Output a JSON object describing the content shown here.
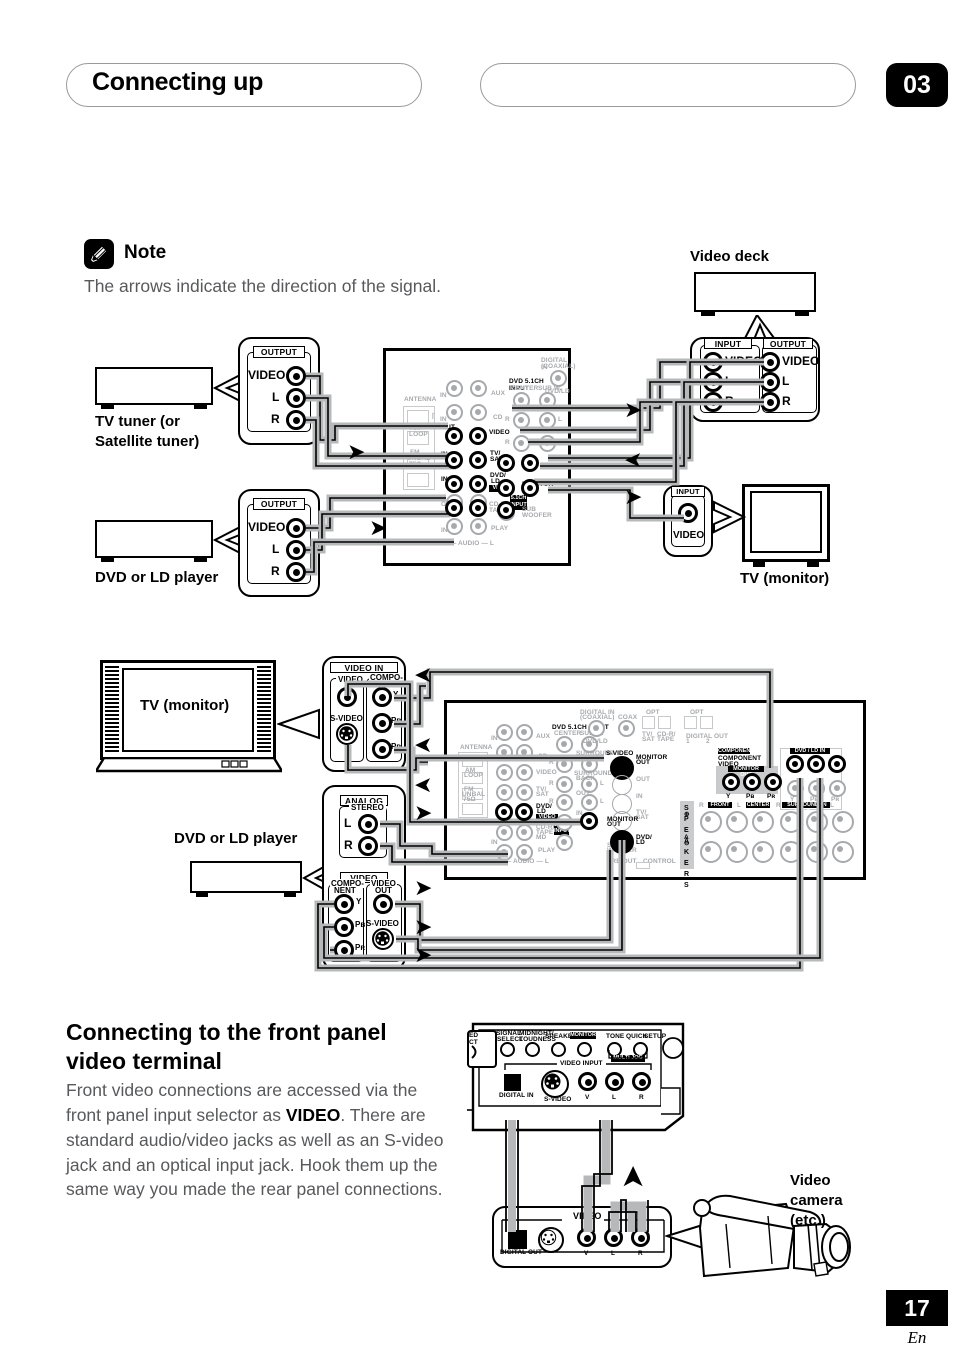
{
  "header": {
    "title": "Connecting up",
    "chapter": "03"
  },
  "note": {
    "icon": "pencil-note-icon",
    "label": "Note",
    "text": "The arrows indicate the direction of the signal."
  },
  "diagram_top": {
    "devices": {
      "tv_tuner": "TV tuner (or\nSatellite tuner)",
      "tv_tuner_line1": "TV tuner (or",
      "tv_tuner_line2": "Satellite tuner)",
      "dvd_player": "DVD or LD player",
      "video_deck": "Video deck",
      "tv_monitor": "TV (monitor)"
    },
    "tuner_panel": {
      "caption": "OUTPUT",
      "jacks": [
        "VIDEO",
        "L",
        "R"
      ]
    },
    "dvd_panel": {
      "caption": "OUTPUT",
      "jacks": [
        "VIDEO",
        "L",
        "R"
      ]
    },
    "deck_panel": {
      "caption_in": "INPUT",
      "caption_out": "OUTPUT",
      "in_jacks": [
        "VIDEO",
        "L",
        "R"
      ],
      "out_jacks": [
        "VIDEO",
        "L",
        "R"
      ]
    },
    "tv_panel": {
      "caption": "INPUT",
      "jack": "VIDEO"
    },
    "receiver_labels": [
      "ANTENNA",
      "AM LOOP",
      "FM UNBAL 75Ω",
      "AUX",
      "CD",
      "DVD 5.1CH INPUT",
      "CENTER",
      "SUB W.",
      "SURROUND",
      "BACK",
      "DIGITAL IN",
      "OUT",
      "IN",
      "TV/SAT",
      "DVD/LD",
      "VIDEO",
      "CD-R/TAPE/MD",
      "PLAY",
      "MONITOR OUT",
      "SUB WOOFER",
      "R — AUDIO — L",
      "5.1CH INPUT"
    ],
    "arrows": [
      "right",
      "right",
      "right",
      "left",
      "right",
      "right"
    ]
  },
  "diagram_bottom": {
    "devices": {
      "tv_monitor": "TV (monitor)",
      "dvd_player": "DVD or LD player"
    },
    "tv_panel": {
      "caption": "VIDEO IN",
      "group_video": "VIDEO",
      "group_component": "COMPO-\nNENT",
      "group_component_l1": "COMPO-",
      "group_component_l2": "NENT",
      "svideo": "S-VIDEO",
      "component_jacks": [
        "Y",
        "Pʙ",
        "Pʀ"
      ]
    },
    "dvd_panel": {
      "analog_caption": "ANALOG",
      "analog_sub": "STEREO",
      "analog_jacks": [
        "L",
        "R"
      ],
      "video_caption": "VIDEO",
      "component_l1": "COMPO-",
      "component_l2": "NENT",
      "video_out_l1": "VIDEO",
      "video_out_l2": "OUT",
      "svideo": "S-VIDEO",
      "component_jacks": [
        "Y",
        "Pʙ",
        "Pʀ"
      ]
    },
    "receiver_labels": [
      "ANTENNA",
      "AM LOOP",
      "FM UNBAL 75Ω",
      "AUX",
      "CD",
      "DVD 5.1CH INPUT",
      "CENTER",
      "SUB W.",
      "SURROUND",
      "SURROUND BACK",
      "DIGITAL IN",
      "COAX",
      "OPT",
      "DIGITAL OUT",
      "S-VIDEO",
      "MONITOR OUT",
      "OUT",
      "IN",
      "TV/SAT",
      "DVD/LD",
      "VIDEO",
      "CD-R/TAPE/MD",
      "PLAY",
      "SUB WOOFER",
      "PRE OUT",
      "CONTROL",
      "COMPONENT VIDEO",
      "MONITOR OUT",
      "Y",
      "Pʙ",
      "Pʀ",
      "DVD/LD IN",
      "TV/SAT IN",
      "SPEAKERS",
      "FRONT",
      "CENTER",
      "SURROUND BACK",
      "A",
      "B",
      "R",
      "L"
    ],
    "arrows": [
      "left",
      "left",
      "left",
      "right",
      "right",
      "right",
      "right"
    ]
  },
  "section": {
    "title_line1": "Connecting to the front panel",
    "title_line2": "video terminal",
    "body_pre": "Front video connections are accessed via the front panel input selector as ",
    "body_bold": "VIDEO",
    "body_post": ". There are standard audio/video jacks as well as an S-video jack and an optical input jack. Hook them up the same way you made the rear panel connections."
  },
  "front_panel": {
    "controls": [
      {
        "l1": "SIGNAL",
        "l2": "SELECT"
      },
      {
        "l1": "MIDNIGHT/",
        "l2": "LOUDNESS"
      },
      {
        "l1": "SPEAKERS",
        "l2": ""
      },
      {
        "l1": "MONITOR",
        "l2": ""
      },
      {
        "l1": "TONE",
        "l2": ""
      },
      {
        "l1": "QUICK",
        "l2": "SETUP"
      }
    ],
    "selector_label": "SELECT",
    "multi_jog": "MULTI JOG",
    "video_input": "VIDEO INPUT",
    "digital_in": "DIGITAL IN",
    "svideo": "S-VIDEO",
    "jacks": [
      "V",
      "L",
      "R"
    ]
  },
  "camera": {
    "label_l1": "Video",
    "label_l2": "camera",
    "label_l3": "(etc.)",
    "panel_caption": "VIDEO",
    "digital_out": "DIGITAL OUT",
    "svideo": "S-VIDEO",
    "jacks": [
      "V",
      "L",
      "R"
    ]
  },
  "footer": {
    "page": "17",
    "lang": "En"
  }
}
